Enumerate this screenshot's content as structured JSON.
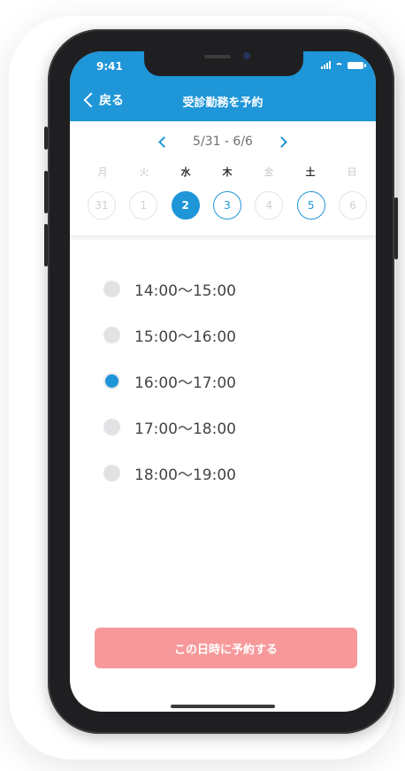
{
  "status_bar": {
    "time": "9:41"
  },
  "header": {
    "back_label": "戻る",
    "title": "受診勤務を予約"
  },
  "week": {
    "range": "5/31 - 6/6"
  },
  "weekdays": [
    {
      "label": "月",
      "active": false
    },
    {
      "label": "火",
      "active": false
    },
    {
      "label": "水",
      "active": true
    },
    {
      "label": "木",
      "active": true
    },
    {
      "label": "金",
      "active": false
    },
    {
      "label": "土",
      "active": true
    },
    {
      "label": "日",
      "active": false
    }
  ],
  "dates": [
    {
      "label": "31",
      "state": "disabled"
    },
    {
      "label": "1",
      "state": "disabled"
    },
    {
      "label": "2",
      "state": "selected"
    },
    {
      "label": "3",
      "state": "available"
    },
    {
      "label": "4",
      "state": "disabled"
    },
    {
      "label": "5",
      "state": "available"
    },
    {
      "label": "6",
      "state": "disabled"
    }
  ],
  "time_slots": [
    {
      "label": "14:00〜15:00",
      "selected": false
    },
    {
      "label": "15:00〜16:00",
      "selected": false
    },
    {
      "label": "16:00〜17:00",
      "selected": true
    },
    {
      "label": "17:00〜18:00",
      "selected": false
    },
    {
      "label": "18:00〜19:00",
      "selected": false
    }
  ],
  "reserve_button": {
    "label": "この日時に予約する"
  },
  "colors": {
    "primary": "#1e96d8",
    "button": "#f7999b",
    "disabled": "#cfcfd3"
  }
}
